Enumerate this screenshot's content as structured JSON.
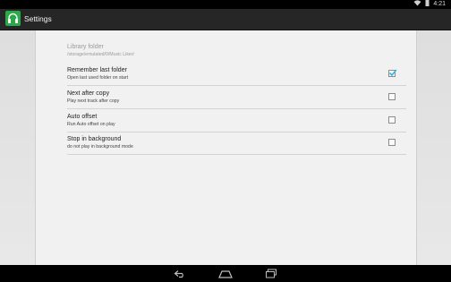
{
  "status_bar": {
    "time": "4:21",
    "icons": [
      "wifi-icon",
      "battery-icon"
    ]
  },
  "action_bar": {
    "icon": "headphones-icon",
    "title": "Settings",
    "accent_color": "#2aa84a"
  },
  "preferences": [
    {
      "title": "Library folder",
      "summary": "/storage/emulated/0/Music Liker/",
      "enabled": false,
      "has_checkbox": false
    },
    {
      "title": "Remember last folder",
      "summary": "Open last used folder on start",
      "enabled": true,
      "has_checkbox": true,
      "checked": true
    },
    {
      "title": "Next after copy",
      "summary": "Play next track after copy",
      "enabled": true,
      "has_checkbox": true,
      "checked": false
    },
    {
      "title": "Auto offset",
      "summary": "Run Auto offset on play",
      "enabled": true,
      "has_checkbox": true,
      "checked": false
    },
    {
      "title": "Stop in background",
      "summary": "do not play in background mode",
      "enabled": true,
      "has_checkbox": true,
      "checked": false
    }
  ],
  "nav_bar": {
    "buttons": [
      "back-icon",
      "home-icon",
      "recent-apps-icon"
    ]
  },
  "colors": {
    "check_color": "#33b5e5"
  }
}
